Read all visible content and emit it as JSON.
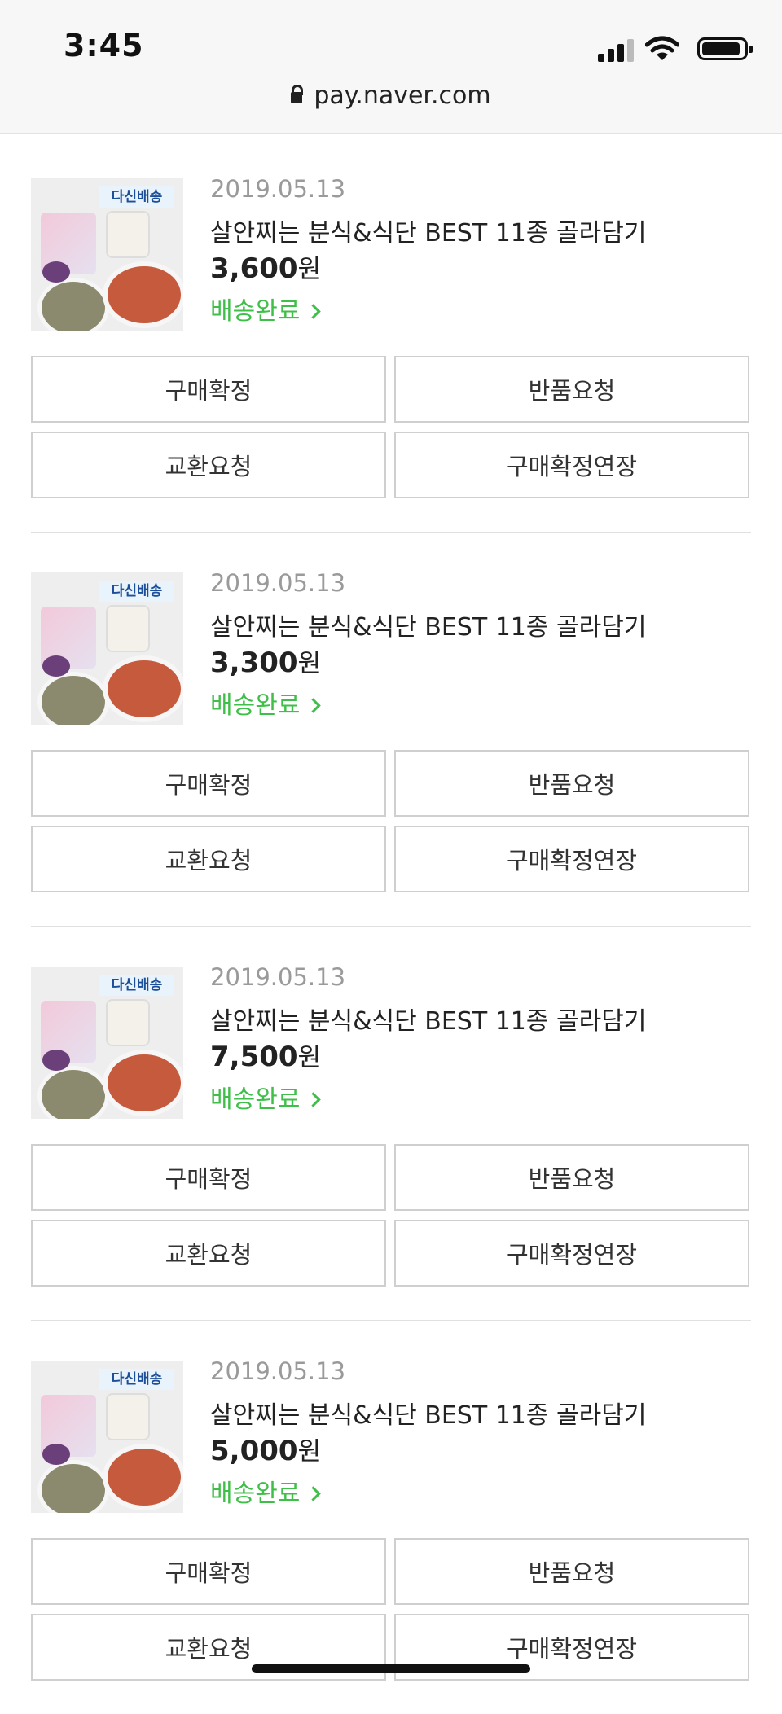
{
  "status_bar": {
    "time": "3:45"
  },
  "browser": {
    "url": "pay.naver.com"
  },
  "orders": [
    {
      "date": "2019.05.13",
      "title": "살안찌는 분식&식단 BEST 11종 골라담기",
      "price": "3,600",
      "currency": "원",
      "status": "배송완료",
      "thumb_label": "다신배송"
    },
    {
      "date": "2019.05.13",
      "title": "살안찌는 분식&식단 BEST 11종 골라담기",
      "price": "3,300",
      "currency": "원",
      "status": "배송완료",
      "thumb_label": "다신배송"
    },
    {
      "date": "2019.05.13",
      "title": "살안찌는 분식&식단 BEST 11종 골라담기",
      "price": "7,500",
      "currency": "원",
      "status": "배송완료",
      "thumb_label": "다신배송"
    },
    {
      "date": "2019.05.13",
      "title": "살안찌는 분식&식단 BEST 11종 골라담기",
      "price": "5,000",
      "currency": "원",
      "status": "배송완료",
      "thumb_label": "다신배송"
    }
  ],
  "actions": {
    "confirm_purchase": "구매확정",
    "return_request": "반품요청",
    "exchange_request": "교환요청",
    "extend_confirmation": "구매확정연장"
  },
  "colors": {
    "status_green": "#3fbf49",
    "border": "#cfcfcf"
  }
}
